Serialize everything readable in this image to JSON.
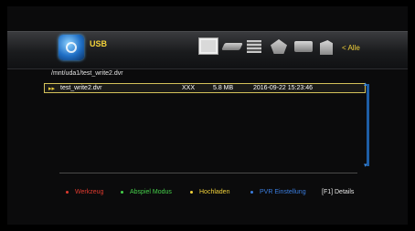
{
  "header": {
    "title": "USB",
    "filter_label": "< Alle"
  },
  "icons": [
    "video-icon",
    "audio-icon",
    "picture-icon",
    "recording-icon",
    "network-icon",
    "all-files-icon"
  ],
  "path": "/mnt/uda1/test_write2.dvr",
  "files": [
    {
      "name": "test_write2.dvr",
      "owner": "XXX",
      "size": "5.8 MB",
      "date": "2016-09-22 15:23:46"
    }
  ],
  "footer": {
    "red": "Werkzeug",
    "green": "Abspiel Modus",
    "yellow": "Hochladen",
    "blue": "PVR Einstellung",
    "f1": "[F1] Details"
  },
  "colors": {
    "red": "#e03a2f",
    "green": "#46d04a",
    "yellow": "#f2d23a",
    "blue": "#3b7ee0",
    "accent": "#f2d23a"
  }
}
